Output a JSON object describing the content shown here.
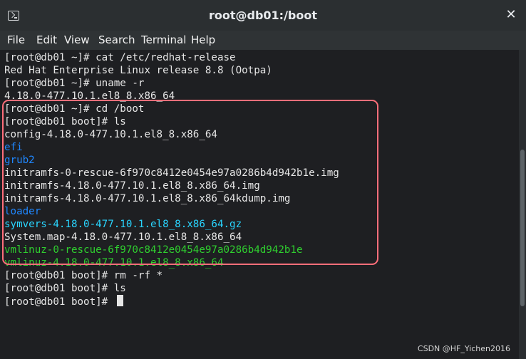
{
  "window": {
    "title": "root@db01:/boot"
  },
  "menubar": {
    "items": [
      "File",
      "Edit",
      "View",
      "Search",
      "Terminal",
      "Help"
    ]
  },
  "terminal": {
    "lines": [
      {
        "text": "[root@db01 ~]# cat /etc/redhat-release",
        "color": "#e6e6e6"
      },
      {
        "text": "Red Hat Enterprise Linux release 8.8 (Ootpa)",
        "color": "#e6e6e6"
      },
      {
        "text": "[root@db01 ~]# uname -r",
        "color": "#e6e6e6"
      },
      {
        "text": "4.18.0-477.10.1.el8_8.x86_64",
        "color": "#e6e6e6"
      },
      {
        "text": "[root@db01 ~]# cd /boot",
        "color": "#e6e6e6"
      },
      {
        "text": "[root@db01 boot]# ls",
        "color": "#e6e6e6"
      },
      {
        "text": "config-4.18.0-477.10.1.el8_8.x86_64",
        "color": "#e6e6e6"
      },
      {
        "text": "efi",
        "color": "#1f87ff"
      },
      {
        "text": "grub2",
        "color": "#1f87ff"
      },
      {
        "text": "initramfs-0-rescue-6f970c8412e0454e97a0286b4d942b1e.img",
        "color": "#e6e6e6"
      },
      {
        "text": "initramfs-4.18.0-477.10.1.el8_8.x86_64.img",
        "color": "#e6e6e6"
      },
      {
        "text": "initramfs-4.18.0-477.10.1.el8_8.x86_64kdump.img",
        "color": "#e6e6e6"
      },
      {
        "text": "loader",
        "color": "#1f87ff"
      },
      {
        "text": "symvers-4.18.0-477.10.1.el8_8.x86_64.gz",
        "color": "#29d5ff"
      },
      {
        "text": "System.map-4.18.0-477.10.1.el8_8.x86_64",
        "color": "#e6e6e6"
      },
      {
        "text": "vmlinuz-0-rescue-6f970c8412e0454e97a0286b4d942b1e",
        "color": "#2fcf2f"
      },
      {
        "text": "vmlinuz-4.18.0-477.10.1.el8_8.x86_64",
        "color": "#2fcf2f"
      },
      {
        "text": "[root@db01 boot]# rm -rf *",
        "color": "#e6e6e6"
      },
      {
        "text": "[root@db01 boot]# ls",
        "color": "#e6e6e6"
      },
      {
        "text": "[root@db01 boot]# ",
        "color": "#e6e6e6"
      }
    ]
  },
  "watermark": "CSDN @HF_Yichen2016",
  "icons": {
    "terminal": "terminal-icon",
    "close": "close-icon"
  }
}
